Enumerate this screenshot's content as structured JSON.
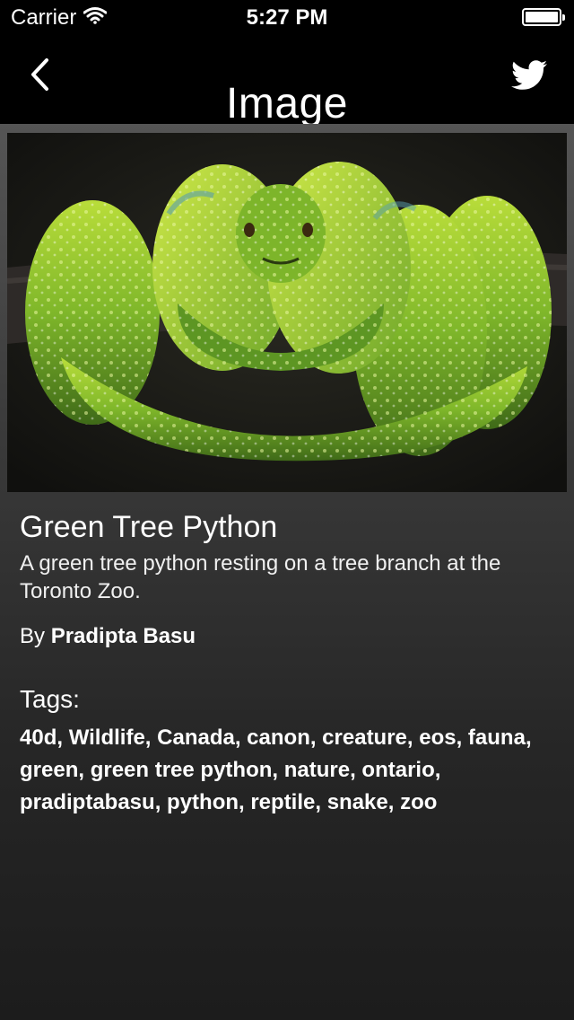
{
  "status_bar": {
    "carrier": "Carrier",
    "time": "5:27 PM"
  },
  "nav": {
    "title": "Image",
    "back_icon": "chevron-left-icon",
    "share_icon": "twitter-bird-icon"
  },
  "photo": {
    "subject": "green tree python coiled on branch"
  },
  "details": {
    "title": "Green Tree Python",
    "description": "A green tree python resting on a tree branch at the Toronto Zoo.",
    "by_label": "By",
    "author": "Pradipta Basu",
    "tags_label": "Tags:",
    "tags": "40d, Wildlife, Canada, canon, creature, eos, fauna, green, green tree python, nature, ontario, pradiptabasu, python, reptile, snake, zoo"
  },
  "colors": {
    "bar_background": "#000000",
    "content_top": "#555555",
    "content_bottom": "#1c1c1c",
    "text": "#ffffff"
  }
}
